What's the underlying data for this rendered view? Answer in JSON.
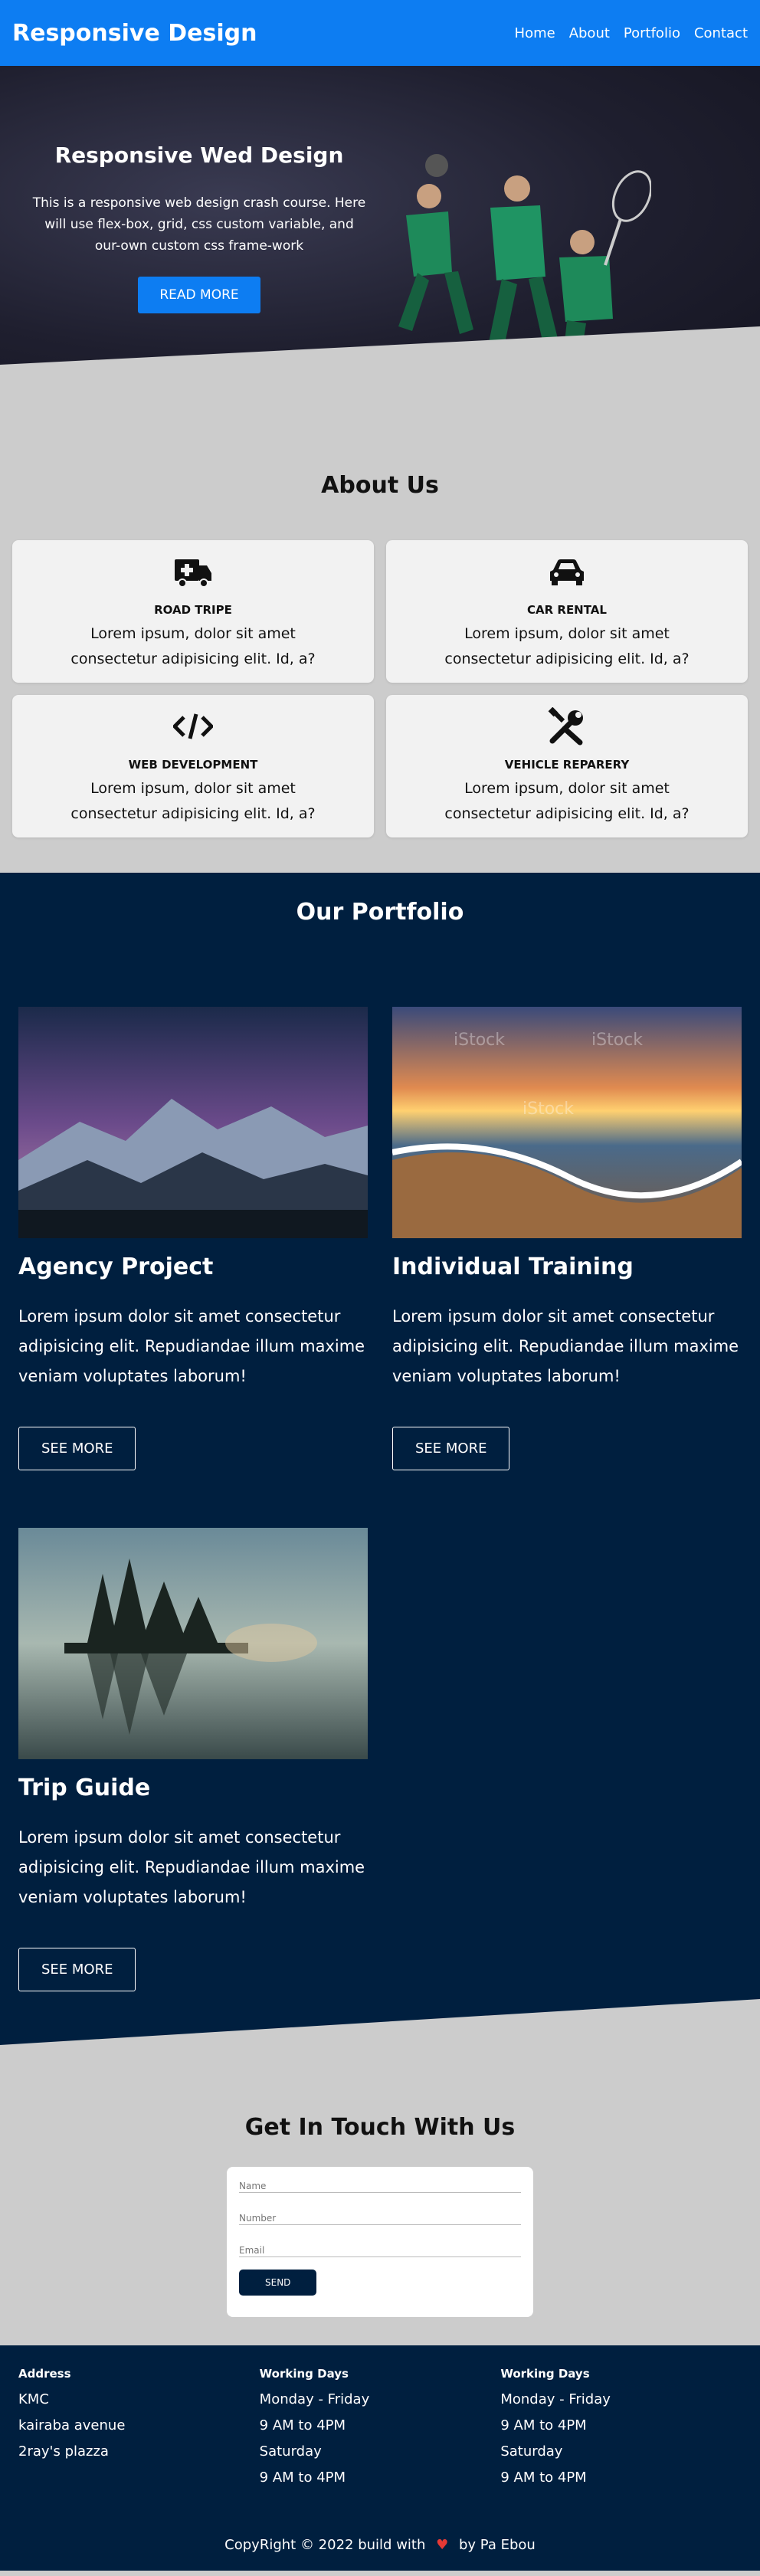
{
  "nav": {
    "brand": "Responsive Design",
    "links": [
      "Home",
      "About",
      "Portfolio",
      "Contact"
    ]
  },
  "hero": {
    "title": "Responsive Wed Design",
    "description": "This is a responsive web design crash course. Here will use flex-box, grid, css custom variable, and our-own custom css frame-work",
    "button": "READ MORE"
  },
  "about": {
    "title": "About Us",
    "cards": [
      {
        "title": "ROAD TRIPE",
        "text": "Lorem ipsum, dolor sit amet consectetur adipisicing elit. Id, a?",
        "icon": "ambulance-icon"
      },
      {
        "title": "CAR RENTAL",
        "text": "Lorem ipsum, dolor sit amet consectetur adipisicing elit. Id, a?",
        "icon": "car-icon"
      },
      {
        "title": "WEB DEVELOPMENT",
        "text": "Lorem ipsum, dolor sit amet consectetur adipisicing elit. Id, a?",
        "icon": "code-icon"
      },
      {
        "title": "VEHICLE REPARERY",
        "text": "Lorem ipsum, dolor sit amet consectetur adipisicing elit. Id, a?",
        "icon": "tools-icon"
      }
    ]
  },
  "portfolio": {
    "title": "Our Portfolio",
    "projects": [
      {
        "title": "Agency Project",
        "text": "Lorem ipsum dolor sit amet consectetur adipisicing elit. Repudiandae illum maxime veniam voluptates laborum!",
        "button": "SEE MORE"
      },
      {
        "title": "Individual Training",
        "text": "Lorem ipsum dolor sit amet consectetur adipisicing elit. Repudiandae illum maxime veniam voluptates laborum!",
        "button": "SEE MORE"
      },
      {
        "title": "Trip Guide",
        "text": "Lorem ipsum dolor sit amet consectetur adipisicing elit. Repudiandae illum maxime veniam voluptates laborum!",
        "button": "SEE MORE"
      }
    ],
    "watermark": "iStock"
  },
  "contact": {
    "title": "Get In Touch With Us",
    "name_placeholder": "Name",
    "number_placeholder": "Number",
    "email_placeholder": "Email",
    "send": "SEND"
  },
  "footer": {
    "columns": [
      {
        "heading": "Address",
        "lines": [
          "KMC",
          "kairaba avenue",
          "2ray's plazza"
        ]
      },
      {
        "heading": "Working Days",
        "lines": [
          "Monday - Friday",
          "9 AM to 4PM",
          "Saturday",
          "9 AM to 4PM"
        ]
      },
      {
        "heading": "Working Days",
        "lines": [
          "Monday - Friday",
          "9 AM to 4PM",
          "Saturday",
          "9 AM to 4PM"
        ]
      }
    ],
    "copy_left": "CopyRight © 2022 build with",
    "copy_right": "by Pa Ebou"
  },
  "colors": {
    "primary": "#0d7df2",
    "navy": "#001f3f",
    "gray": "#cccccc",
    "heart": "#e53935"
  }
}
